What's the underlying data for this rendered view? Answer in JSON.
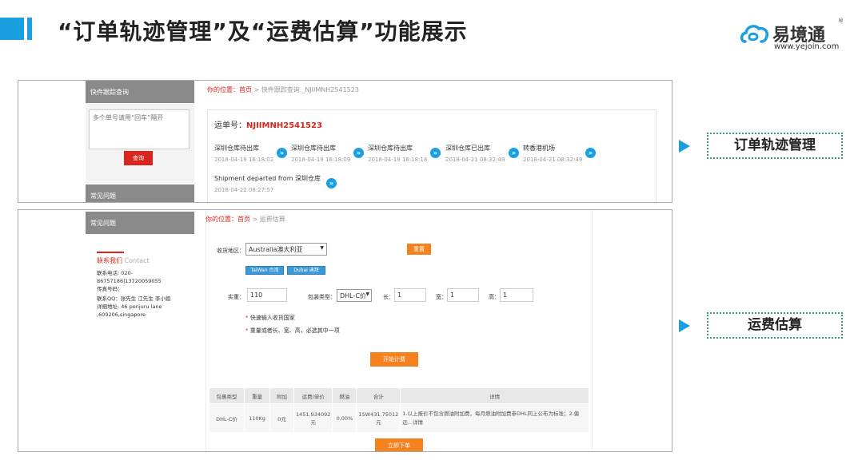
{
  "header": {
    "title": "“订单轨迹管理”及“运费估算”功能展示"
  },
  "logo": {
    "name": "易境通",
    "url": "www.yejoin.com",
    "reg": "®"
  },
  "colors": {
    "accent": "#1a9fe0",
    "red": "#d9261c",
    "orange": "#f5821f"
  },
  "panel1": {
    "side_title": "快件跟踪查询",
    "textarea_placeholder": "多个单号请用“回车”隔开",
    "query_button": "查询",
    "faq_title": "常见问题",
    "breadcrumb_prefix": "你的位置：",
    "breadcrumb_home": "首页",
    "breadcrumb_rest": " > 快件跟踪查询 _NJIIMNH2541523",
    "waybill_label": "运单号：",
    "waybill_no": "NJIIMNH2541523",
    "steps": [
      {
        "text": "深圳仓库待出库",
        "time": "2018-04-19 16:18:02"
      },
      {
        "text": "深圳仓库待出库",
        "time": "2018-04-19 16:18:09"
      },
      {
        "text": "深圳仓库待出库",
        "time": "2018-04-19 16:18:18"
      },
      {
        "text": "深圳仓库已出库",
        "time": "2018-04-21 08:32:49"
      },
      {
        "text": "转香港机场",
        "time": "2018-04-21 08:32:49"
      }
    ],
    "step_last": {
      "text": "Shipment departed from 深圳仓库",
      "time": "2018-04-22 08:27:57"
    }
  },
  "panel2": {
    "side_title": "常见问题",
    "breadcrumb_prefix": "你的位置：",
    "breadcrumb_home": "首页",
    "breadcrumb_rest": " > 运费估算",
    "contact_title": "联系我们",
    "contact_title_en": "Contact",
    "contact_lines": [
      "联系电话: 020-",
      "86757186|13720059055",
      "传真号码：",
      "联系QQ：张先生 江先生 李小姐",
      "详细地址: 46 penjuru lane",
      ",609206,singapore"
    ],
    "dest_label": "收货地区：",
    "dest_value": "Australia澳大利亚",
    "reset_button": "重置",
    "region_buttons": [
      "TaiWan 台湾",
      "Dubai 迪拜"
    ],
    "weight_label": "实重：",
    "weight_value": "110",
    "pack_label": "包装类型：",
    "pack_value": "DHL-C价",
    "len_label": "长：",
    "len_value": "1",
    "wid_label": "宽：",
    "wid_value": "1",
    "hei_label": "高：",
    "hei_value": "1",
    "note1": "快速输入收货国家",
    "note2": "重量或者长、宽、高，必选其中一项",
    "calc_button": "开始计费",
    "table_headers": [
      "包裹类型",
      "重量",
      "附加",
      "运费/单价",
      "燃油",
      "合计",
      "详情"
    ],
    "table_row": [
      "DHL-C价",
      "110Kg",
      "0元",
      "1451.934092元",
      "0.00%",
      "1SW431.75012元",
      "1.以上报价不包含燃油附加费，每月燃油附加费参DHL同上公布为标准；2.偏远...详情"
    ],
    "order_button": "立即下单"
  },
  "labels": {
    "track": "订单轨迹管理",
    "freight": "运费估算"
  }
}
